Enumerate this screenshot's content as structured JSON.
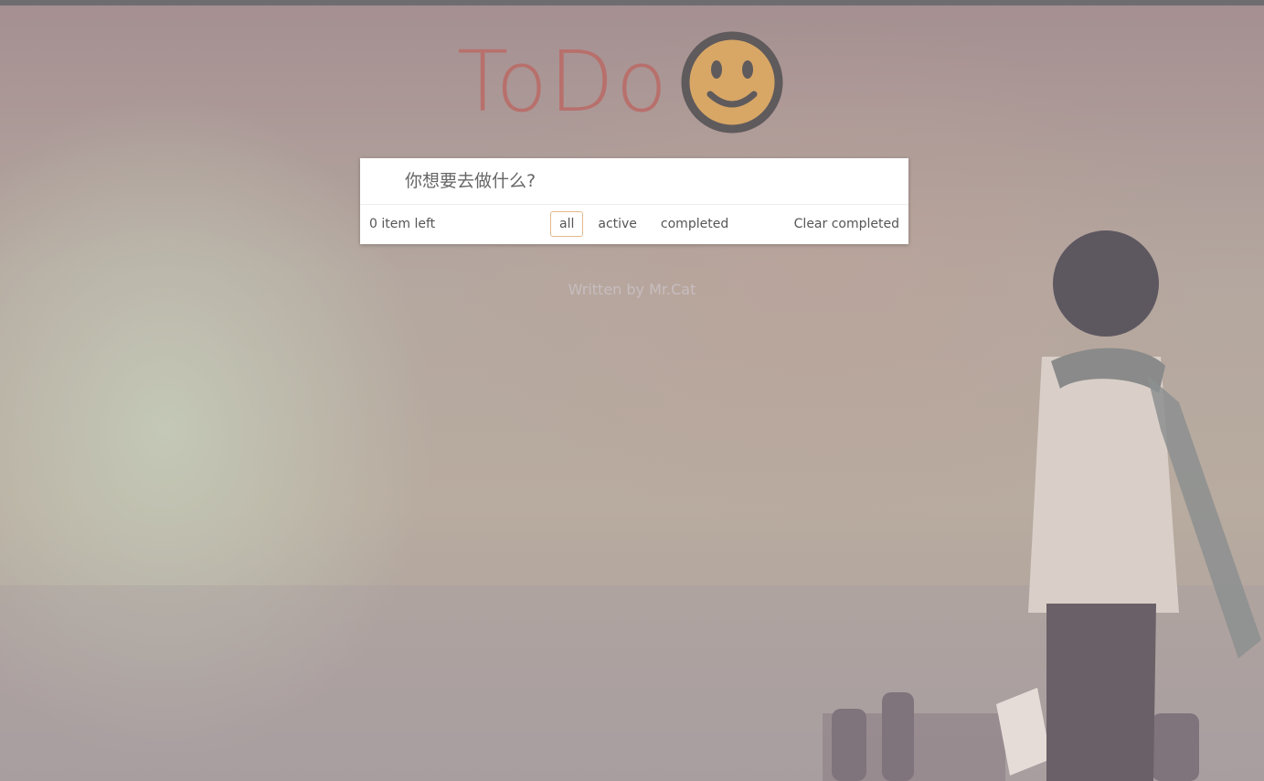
{
  "app": {
    "title": "ToDo",
    "logo_icon": "smiley-face-icon"
  },
  "input": {
    "placeholder": "你想要去做什么?",
    "value": ""
  },
  "footer": {
    "count_text": "0 item left",
    "filters": [
      {
        "label": "all",
        "selected": true
      },
      {
        "label": "active",
        "selected": false
      },
      {
        "label": "completed",
        "selected": false
      }
    ],
    "clear_label": "Clear completed"
  },
  "info": {
    "credit": "Written by Mr.Cat"
  },
  "colors": {
    "title": "#b8706c",
    "smiley_face": "#d8a766",
    "smiley_outline": "#5f5a5c",
    "selected_filter_border": "#e5b98c"
  }
}
